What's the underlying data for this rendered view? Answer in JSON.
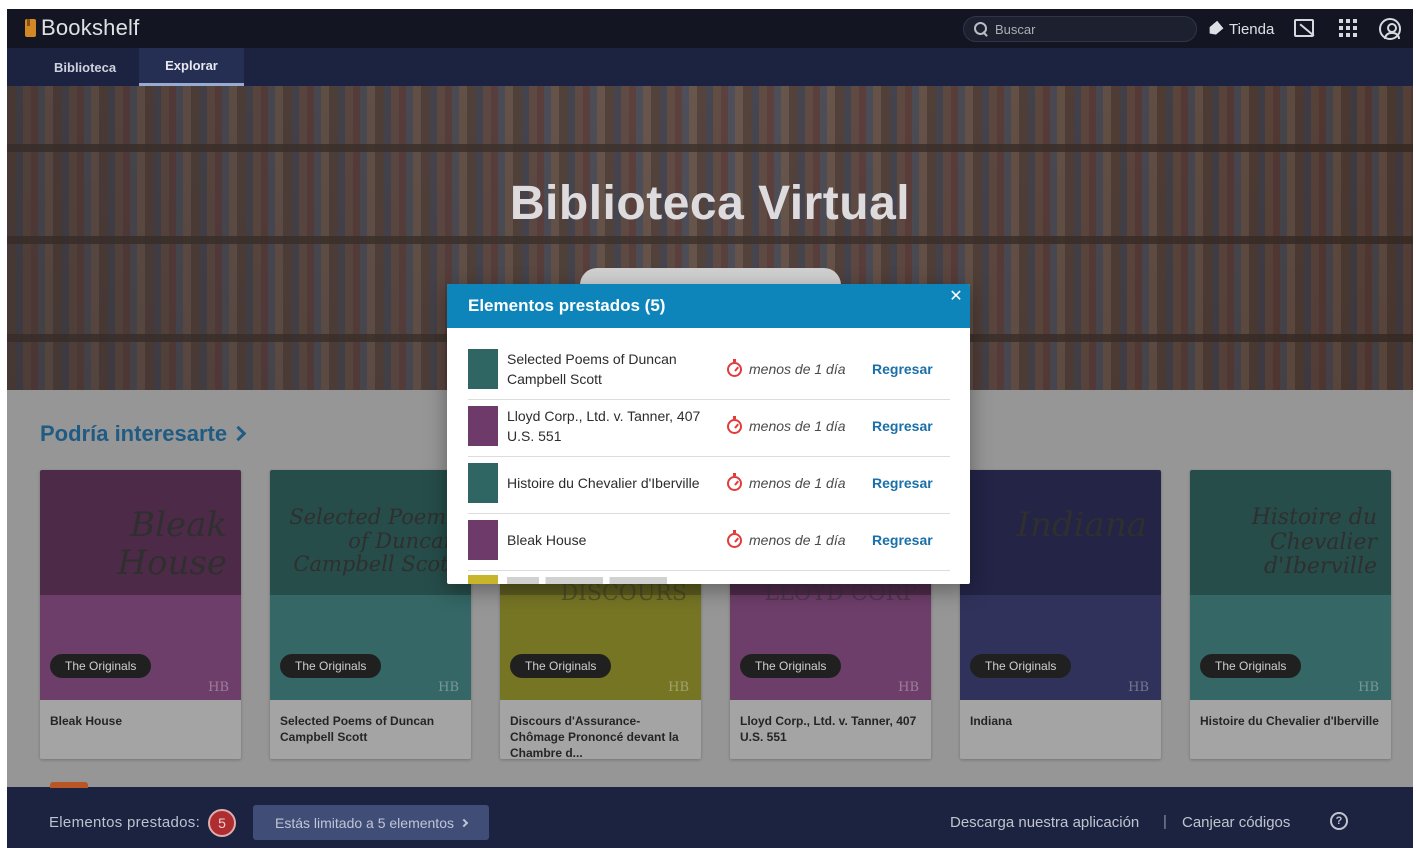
{
  "app": {
    "name": "Bookshelf"
  },
  "topbar": {
    "search_placeholder": "Buscar",
    "store_label": "Tienda"
  },
  "nav": {
    "tabs": [
      {
        "label": "Biblioteca",
        "active": false
      },
      {
        "label": "Explorar",
        "active": true
      }
    ]
  },
  "hero": {
    "title": "Biblioteca Virtual"
  },
  "recommended": {
    "heading": "Podría interesarte",
    "books": [
      {
        "title": "Bleak House",
        "cover_title": "Bleak House",
        "badge": "The Originals",
        "color_top": "#4b2446",
        "color_bottom": "#6d3a6a"
      },
      {
        "title": "Selected Poems of Duncan Campbell Scott",
        "cover_title": "Selected Poems of Duncan Campbell Scott",
        "badge": "The Originals",
        "color_top": "#204a47",
        "color_bottom": "#2f6664"
      },
      {
        "title": "Discours d'Assurance-Chômage Prononcé devant la Chambre d...",
        "cover_title": "DISCOURS",
        "badge": "The Originals",
        "color_top": "#5b5a18",
        "color_bottom": "#77761e"
      },
      {
        "title": "Lloyd Corp., Ltd. v. Tanner, 407 U.S. 551",
        "cover_title": "LLOYD CORP",
        "badge": "The Originals",
        "color_top": "#4b2446",
        "color_bottom": "#6d3a6a"
      },
      {
        "title": "Indiana",
        "cover_title": "Indiana",
        "badge": "The Originals",
        "color_top": "#1d1e43",
        "color_bottom": "#2b2d5a"
      },
      {
        "title": "Histoire du Chevalier d'Iberville",
        "cover_title": "Histoire du Chevalier d'Iberville",
        "badge": "The Originals",
        "color_top": "#204a47",
        "color_bottom": "#2f6664"
      }
    ]
  },
  "modal": {
    "title": "Elementos prestados (5)",
    "items": [
      {
        "title": "Selected Poems of Duncan Campbell Scott",
        "time": "menos de 1 día",
        "action": "Regresar",
        "thumb_color": "#2f6664"
      },
      {
        "title": "Lloyd Corp., Ltd. v. Tanner, 407 U.S. 551",
        "time": "menos de 1 día",
        "action": "Regresar",
        "thumb_color": "#6d3a6a"
      },
      {
        "title": "Histoire du Chevalier d'Iberville",
        "time": "menos de 1 día",
        "action": "Regresar",
        "thumb_color": "#2f6664"
      },
      {
        "title": "Bleak House",
        "time": "menos de 1 día",
        "action": "Regresar",
        "thumb_color": "#6d3a6a"
      }
    ]
  },
  "bottombar": {
    "borrowed_label": "Elementos prestados:",
    "borrowed_count": "5",
    "limit_label": "Estás limitado a 5 elementos",
    "app_link": "Descarga nuestra aplicación",
    "separator": "|",
    "codes_link": "Canjear códigos"
  }
}
